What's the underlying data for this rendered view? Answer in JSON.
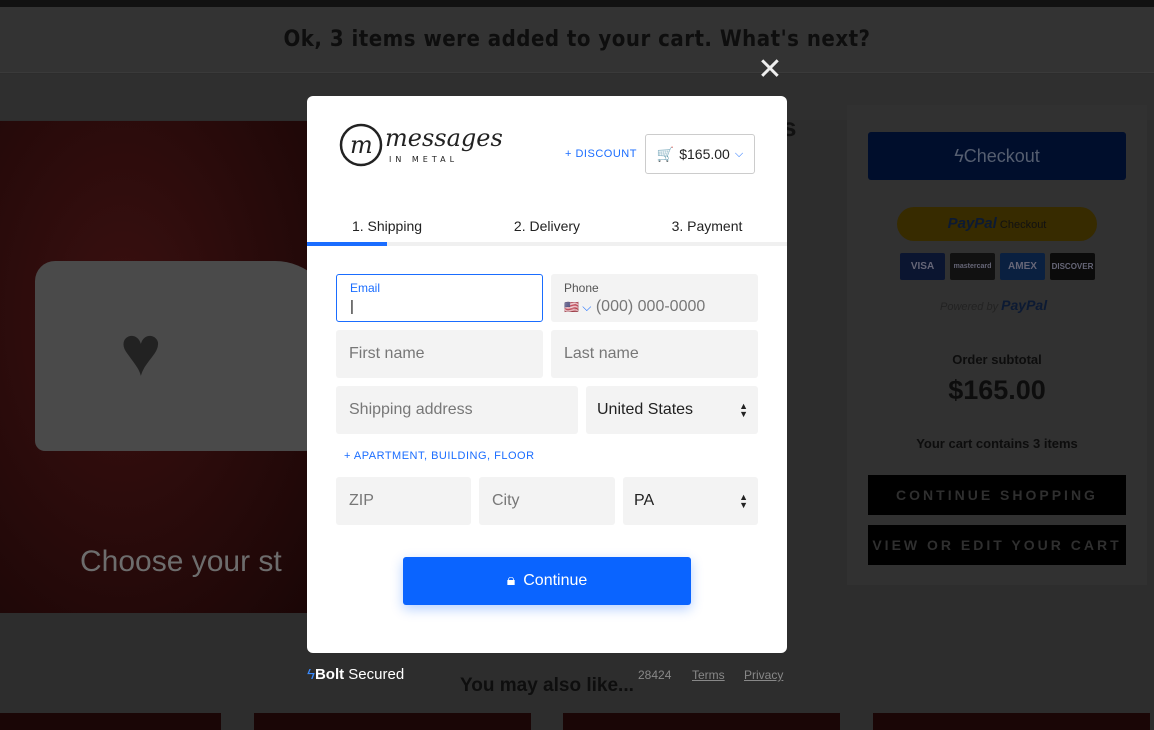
{
  "page": {
    "notice": "Ok, 3 items were added to your cart. What's next?",
    "hero_text": "Choose your st",
    "behind_letter": "s",
    "also_like": "You may also like..."
  },
  "sidebar": {
    "checkout": "Checkout",
    "paypal_brand": "PayPal",
    "paypal_checkout": "Checkout",
    "cards": [
      "VISA",
      "mastercard",
      "AMEX",
      "DISCOVER"
    ],
    "powered_by": "Powered by",
    "powered_brand": "PayPal",
    "subtotal_label": "Order subtotal",
    "subtotal": "$165.00",
    "cart_count": "Your cart contains 3 items",
    "continue_shopping": "CONTINUE SHOPPING",
    "view_cart": "VIEW OR EDIT YOUR CART"
  },
  "modal": {
    "logo": {
      "word": "messages",
      "sub": "IN METAL"
    },
    "discount": "+ DISCOUNT",
    "cart_total": "$165.00",
    "tabs": [
      {
        "label": "1. Shipping",
        "active": true
      },
      {
        "label": "2. Delivery"
      },
      {
        "label": "3. Payment"
      }
    ],
    "progress_fraction": 0.1667,
    "fields": {
      "email_label": "Email",
      "email_value": "",
      "phone_label": "Phone",
      "phone_placeholder": "(000) 000-0000",
      "first_name": "First name",
      "last_name": "Last name",
      "address": "Shipping address",
      "country": "United States",
      "apartment": "+ APARTMENT, BUILDING, FLOOR",
      "zip": "ZIP",
      "city": "City",
      "state": "PA"
    },
    "continue": "Continue"
  },
  "footer": {
    "bolt": "Bolt",
    "secured": "Secured",
    "code": "28424",
    "terms": "Terms",
    "privacy": "Privacy"
  },
  "colors": {
    "accent": "#0a64ff",
    "link": "#1a6dff"
  }
}
